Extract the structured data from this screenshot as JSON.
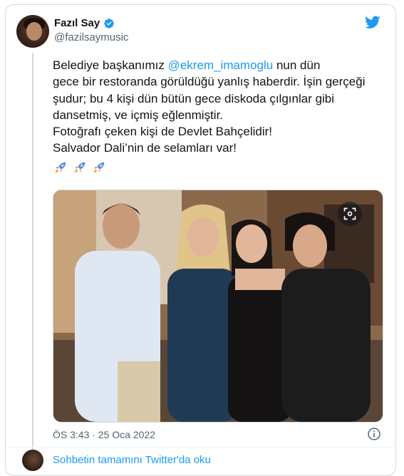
{
  "author": {
    "name": "Fazıl Say",
    "handle": "@fazilsaymusic"
  },
  "tweet": {
    "text_before": "Belediye başkanımız ",
    "mention": "@ekrem_imamoglu",
    "text_after": " nun dün\ngece bir restoranda görüldüğü yanlış haberdir. İşin gerçeği şudur; bu 4 kişi dün bütün gece diskoda çılgınlar gibi dansetmiş, ve içmiş eğlenmiştir.\nFotoğrafı çeken kişi de Devlet Bahçelidir!\nSalvador Dali’nin de selamları var!",
    "timestamp": "ÖS 3:43 · 25 Oca 2022"
  },
  "footer": {
    "thread_link": "Sohbetin tamamını Twitter'da oku"
  },
  "icons": {
    "verified": "verified-badge-icon",
    "brand": "twitter-bird-icon",
    "info": "info-icon",
    "media": "media-view-icon",
    "emoji": "rocket-icon"
  },
  "colors": {
    "accent": "#1d9bf0",
    "text": "#0f1419",
    "secondary": "#536471",
    "border": "#cfd9de"
  }
}
